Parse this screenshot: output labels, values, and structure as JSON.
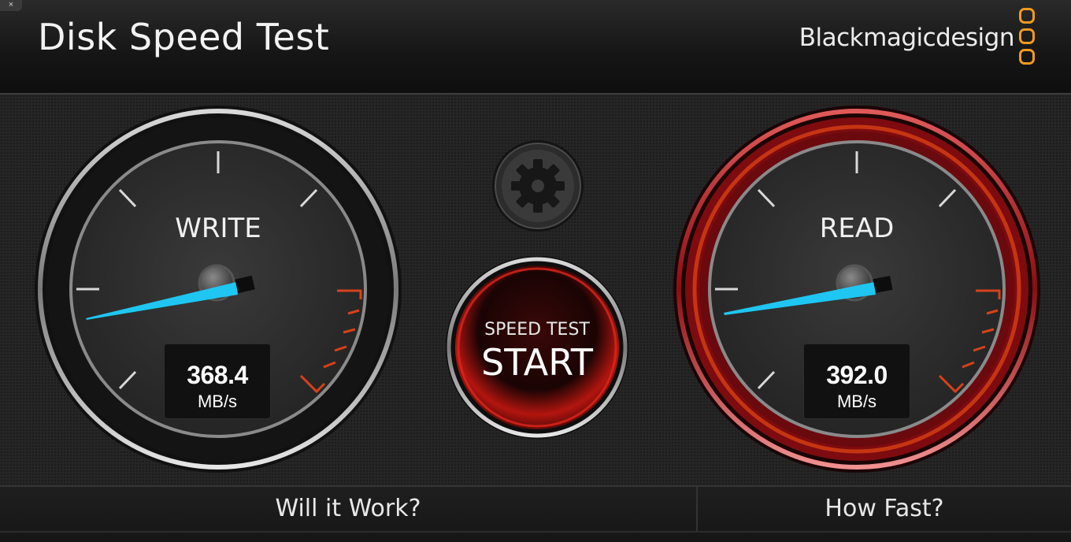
{
  "window": {
    "close_glyph": "×"
  },
  "header": {
    "title": "Disk Speed Test",
    "brand": "Blackmagicdesign",
    "brand_color": "#f39a1f"
  },
  "write_gauge": {
    "label": "WRITE",
    "value": "368.4",
    "unit": "MB/s",
    "needle_color": "#1fc6f2",
    "accent": "#3a3a3a"
  },
  "read_gauge": {
    "label": "READ",
    "value": "392.0",
    "unit": "MB/s",
    "needle_color": "#1fc6f2",
    "accent": "#b3151c"
  },
  "settings": {
    "icon": "gear-icon"
  },
  "start_button": {
    "line1": "SPEED TEST",
    "line2": "START",
    "color": "#c8150f"
  },
  "footer": {
    "left_label": "Will it Work?",
    "right_label": "How Fast?"
  }
}
